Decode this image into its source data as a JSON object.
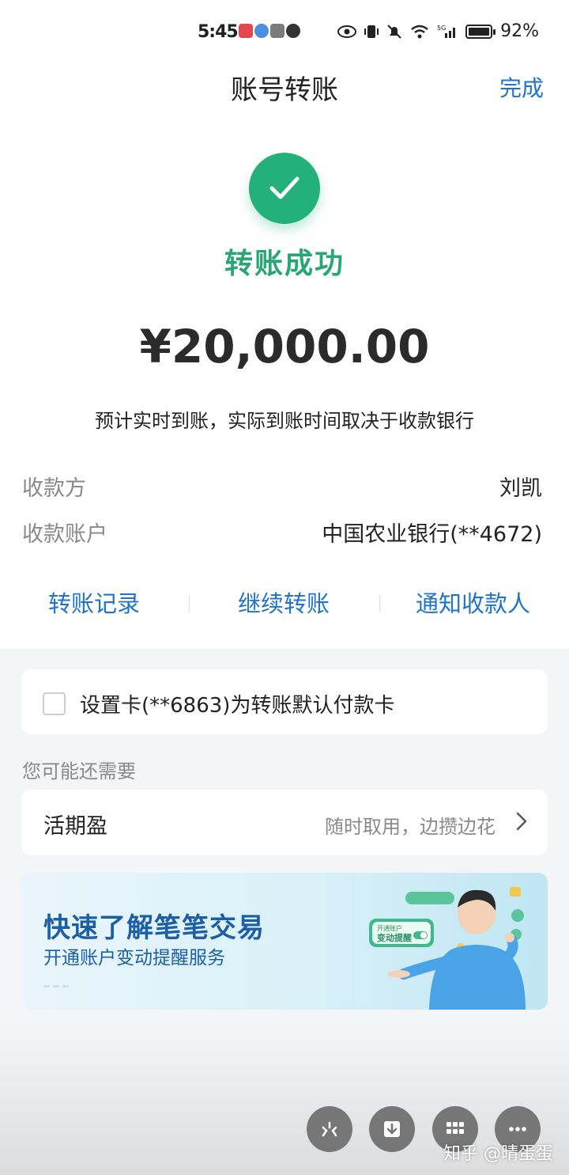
{
  "status_bar": {
    "time": "5:45",
    "battery": "92%",
    "battery_level": 0.92,
    "signal": "5G"
  },
  "header": {
    "title": "账号转账",
    "done_label": "完成"
  },
  "result": {
    "status_text": "转账成功",
    "amount": "¥20,000.00",
    "note": "预计实时到账，实际到账时间取决于收款银行"
  },
  "details": [
    {
      "label": "收款方",
      "value": "刘凯"
    },
    {
      "label": "收款账户",
      "value": "中国农业银行(**4672)"
    }
  ],
  "actions": [
    {
      "label": "转账记录"
    },
    {
      "label": "继续转账"
    },
    {
      "label": "通知收款人"
    }
  ],
  "default_card": {
    "label": "设置卡(**6863)为转账默认付款卡",
    "checked": false
  },
  "recommend": {
    "section_title": "您可能还需要",
    "product_name": "活期盈",
    "product_desc": "随时取用，边攒边花"
  },
  "banner": {
    "title": "快速了解笔笔交易",
    "subtitle": "开通账户变动提醒服务",
    "badge_line1": "开通账户",
    "badge_line2": "变动提醒"
  },
  "watermark": "知乎 @晴蛋蛋",
  "colors": {
    "accent_blue": "#1f73c9",
    "success_green": "#23b07a"
  },
  "fab_icons": [
    "scissors-icon",
    "download-icon",
    "grid-icon",
    "more-icon"
  ]
}
